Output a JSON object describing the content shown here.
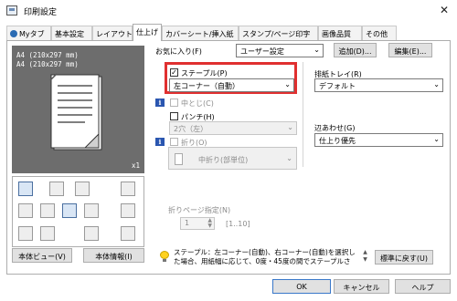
{
  "window": {
    "title": "印刷設定",
    "close_glyph": "✕"
  },
  "tabs": [
    {
      "label": "Myタブ",
      "active": false
    },
    {
      "label": "基本設定",
      "active": false
    },
    {
      "label": "レイアウト",
      "active": false
    },
    {
      "label": "仕上げ",
      "active": true
    },
    {
      "label": "カバーシート/挿入紙",
      "active": false
    },
    {
      "label": "スタンプ/ページ印字",
      "active": false
    },
    {
      "label": "画像品質",
      "active": false
    },
    {
      "label": "その他",
      "active": false
    }
  ],
  "preview": {
    "line1": "A4 (210x297 mm)",
    "line2": "A4 (210x297 mm)",
    "copies": "x1"
  },
  "left_buttons": {
    "printer_view": "本体ビュー(V)",
    "printer_info": "本体情報(I)"
  },
  "favorites": {
    "label": "お気に入り(F)",
    "value": "ユーザー設定",
    "add_button": "追加(D)...",
    "edit_button": "編集(E)..."
  },
  "staple": {
    "label": "ステープル(P)",
    "checked": true,
    "value": "左コーナー（自動）"
  },
  "punch_center": {
    "label": "中とじ(C)"
  },
  "punch": {
    "label": "パンチ(H)",
    "value": "2穴（左）"
  },
  "fold": {
    "label": "折り(O)",
    "value": "中折り(部単位)"
  },
  "fold_page": {
    "label": "折りページ指定(N)",
    "value": "1",
    "range": "[1..10]"
  },
  "output_tray": {
    "label": "排紙トレイ(R)",
    "value": "デフォルト"
  },
  "collate": {
    "label": "辺あわせ(G)",
    "value": "仕上り優先"
  },
  "status_message": {
    "line1": "ステープル：左コーナー(自動)、右コーナー(自動)を選択し",
    "line2": "た場合、用紙幅に応じて、0度・45度の間でステープルさ"
  },
  "restore_default": "標準に戻す(U)",
  "footer": {
    "ok": "OK",
    "cancel": "キャンセル",
    "help": "ヘルプ"
  },
  "info_glyph": "i",
  "check_glyph": "✓",
  "dropdown_glyph": "⌄",
  "icons": {
    "app": "printer-settings-icon",
    "myTab": "user-icon",
    "info": "info-icon",
    "tip": "lightbulb-icon"
  }
}
